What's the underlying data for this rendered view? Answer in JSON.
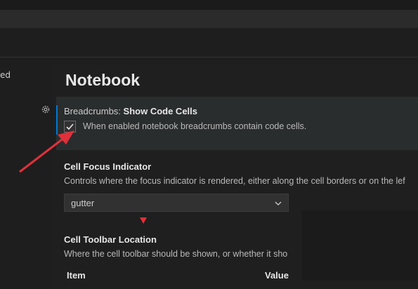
{
  "sidebar": {
    "partial_text": "ed"
  },
  "section": {
    "title": "Notebook"
  },
  "settings": [
    {
      "category": "Breadcrumbs:",
      "name": "Show Code Cells",
      "description": "When enabled notebook breadcrumbs contain code cells.",
      "checked": true
    },
    {
      "name": "Cell Focus Indicator",
      "description": "Controls where the focus indicator is rendered, either along the cell borders or on the lef",
      "value": "gutter"
    },
    {
      "name": "Cell Toolbar Location",
      "description": "Where the cell toolbar should be shown, or whether it sho",
      "table_headers": [
        "Item",
        "Value"
      ]
    }
  ],
  "annotation": {
    "color": "#e0303a"
  },
  "icons": {
    "gear": "gear-icon",
    "check": "check-icon",
    "chevron": "chevron-down-icon"
  }
}
